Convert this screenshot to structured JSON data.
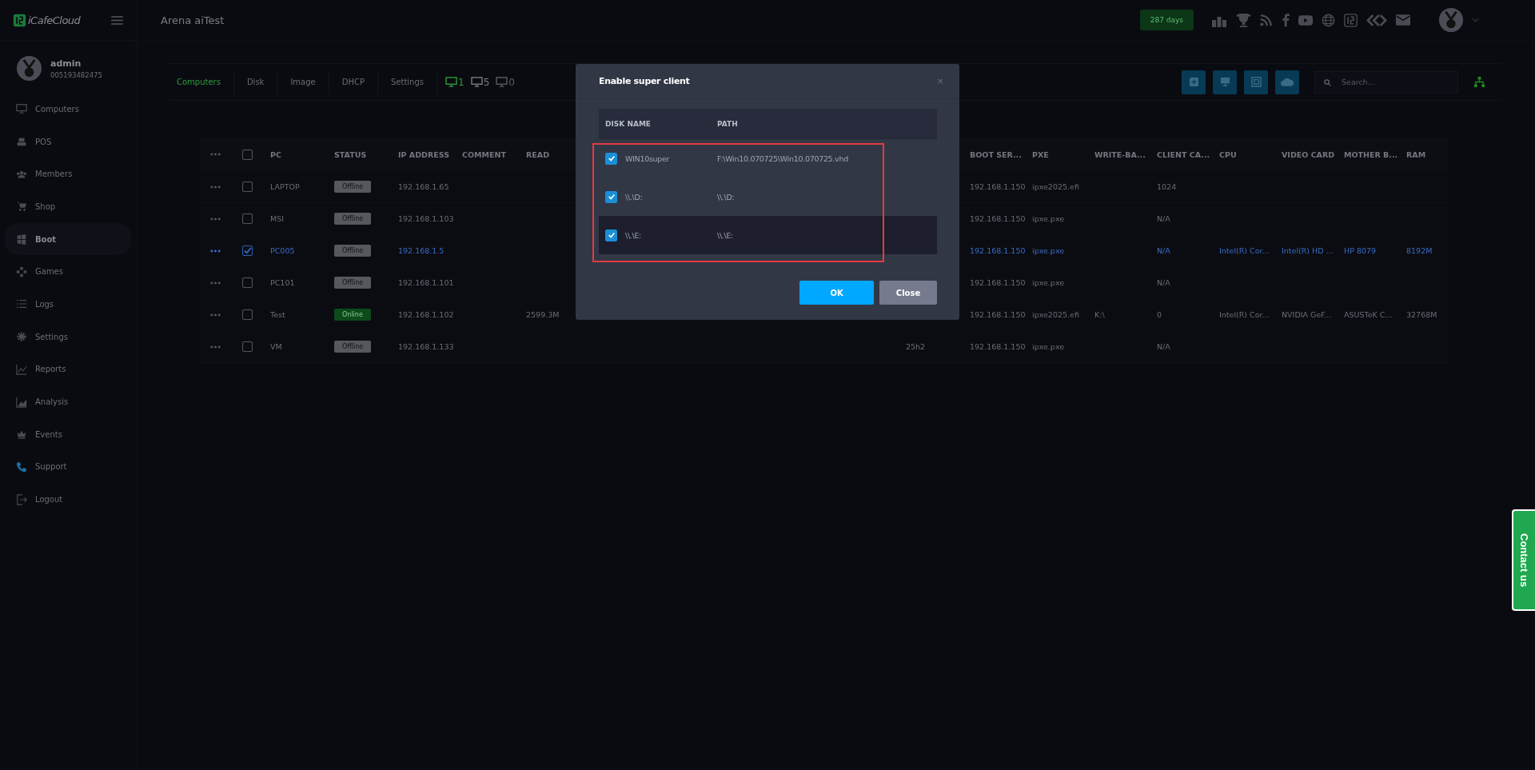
{
  "app": {
    "logo": "iCafeCloud",
    "title": "Arena aiTest",
    "days_badge": "287 days"
  },
  "user": {
    "name": "admin",
    "id": "005193482475"
  },
  "sidebar": {
    "items": [
      {
        "label": "Computers",
        "selected": false
      },
      {
        "label": "POS",
        "selected": false
      },
      {
        "label": "Members",
        "selected": false
      },
      {
        "label": "Shop",
        "selected": false
      },
      {
        "label": "Boot",
        "selected": true
      },
      {
        "label": "Games",
        "selected": false
      },
      {
        "label": "Logs",
        "selected": false
      },
      {
        "label": "Settings",
        "selected": false
      },
      {
        "label": "Reports",
        "selected": false
      },
      {
        "label": "Analysis",
        "selected": false
      },
      {
        "label": "Events",
        "selected": false
      },
      {
        "label": "Support",
        "selected": false
      },
      {
        "label": "Logout",
        "selected": false
      }
    ]
  },
  "tabs": [
    {
      "label": "Computers",
      "selected": true
    },
    {
      "label": "Disk",
      "selected": false
    },
    {
      "label": "Image",
      "selected": false
    },
    {
      "label": "DHCP",
      "selected": false
    },
    {
      "label": "Settings",
      "selected": false
    }
  ],
  "counts": [
    {
      "label": "1",
      "kind": "online"
    },
    {
      "label": "5",
      "kind": "total"
    },
    {
      "label": "0",
      "kind": "idle"
    }
  ],
  "search": {
    "placeholder": "Search..."
  },
  "table": {
    "all_selected": false,
    "columns": {
      "pc": "PC",
      "status": "STATUS",
      "ip": "IP ADDRESS",
      "comment": "COMMENT",
      "read": "READ",
      "boot_server": "BOOT SER...",
      "pxe": "PXE",
      "write_back": "WRITE-BA...",
      "client_cache": "CLIENT CA...",
      "cpu": "CPU",
      "video_card": "VIDEO CARD",
      "motherboard": "MOTHER B...",
      "ram": "RAM"
    },
    "rows": [
      {
        "selected": false,
        "pc": "LAPTOP",
        "status": {
          "label": "Offline",
          "kind": "offline"
        },
        "ip": "192.168.1.65",
        "boot_server": "192.168.1.150",
        "pxe": "ipxe2025.efi",
        "client_cache": "1024"
      },
      {
        "selected": false,
        "pc": "MSI",
        "status": {
          "label": "Offline",
          "kind": "offline"
        },
        "ip": "192.168.1.103",
        "boot_server": "192.168.1.150",
        "pxe": "ipxe.pxe",
        "client_cache": "N/A"
      },
      {
        "selected": true,
        "pc": "PC005",
        "status": {
          "label": "Offline",
          "kind": "offline"
        },
        "ip": "192.168.1.5",
        "boot_server": "192.168.1.150",
        "pxe": "ipxe.pxe",
        "client_cache": "N/A",
        "cpu": "Intel(R) Cor...",
        "video_card": "Intel(R) HD ...",
        "motherboard": "HP 8079",
        "ram": "8192M"
      },
      {
        "selected": false,
        "pc": "PC101",
        "status": {
          "label": "Offline",
          "kind": "offline"
        },
        "ip": "192.168.1.101",
        "boot_server": "192.168.1.150",
        "pxe": "ipxe.pxe",
        "client_cache": "N/A"
      },
      {
        "selected": false,
        "pc": "Test",
        "status": {
          "label": "Online",
          "kind": "online"
        },
        "ip": "192.168.1.102",
        "read": "2599.3M",
        "boot_server": "192.168.1.150",
        "pxe": "ipxe2025.efi",
        "write_back": "K:\\",
        "client_cache": "0",
        "cpu": "Intel(R) Cor...",
        "video_card": "NVIDIA GeF...",
        "motherboard": "ASUSTeK C...",
        "ram": "32768M"
      },
      {
        "selected": false,
        "pc": "VM",
        "status": {
          "label": "Offline",
          "kind": "offline"
        },
        "ip": "192.168.1.133",
        "column_6": "25h2",
        "boot_server": "192.168.1.150",
        "pxe": "ipxe.pxe",
        "client_cache": "N/A"
      }
    ]
  },
  "modal": {
    "title": "Enable super client",
    "close": "×",
    "columns": [
      "DISK NAME",
      "PATH"
    ],
    "rows": [
      {
        "checked": true,
        "hovered": false,
        "disk_name": "WIN10super",
        "path": "F:\\Win10.070725\\Win10.070725.vhd"
      },
      {
        "checked": true,
        "hovered": false,
        "disk_name": "\\\\.\\D:",
        "path": "\\\\.\\D:"
      },
      {
        "checked": true,
        "hovered": true,
        "disk_name": "\\\\.\\E:",
        "path": "\\\\.\\E:"
      }
    ],
    "buttons": [
      {
        "label": "OK",
        "kind": "primary"
      },
      {
        "label": "Close",
        "kind": "secondary"
      }
    ]
  },
  "contact_tab": "Contact us"
}
